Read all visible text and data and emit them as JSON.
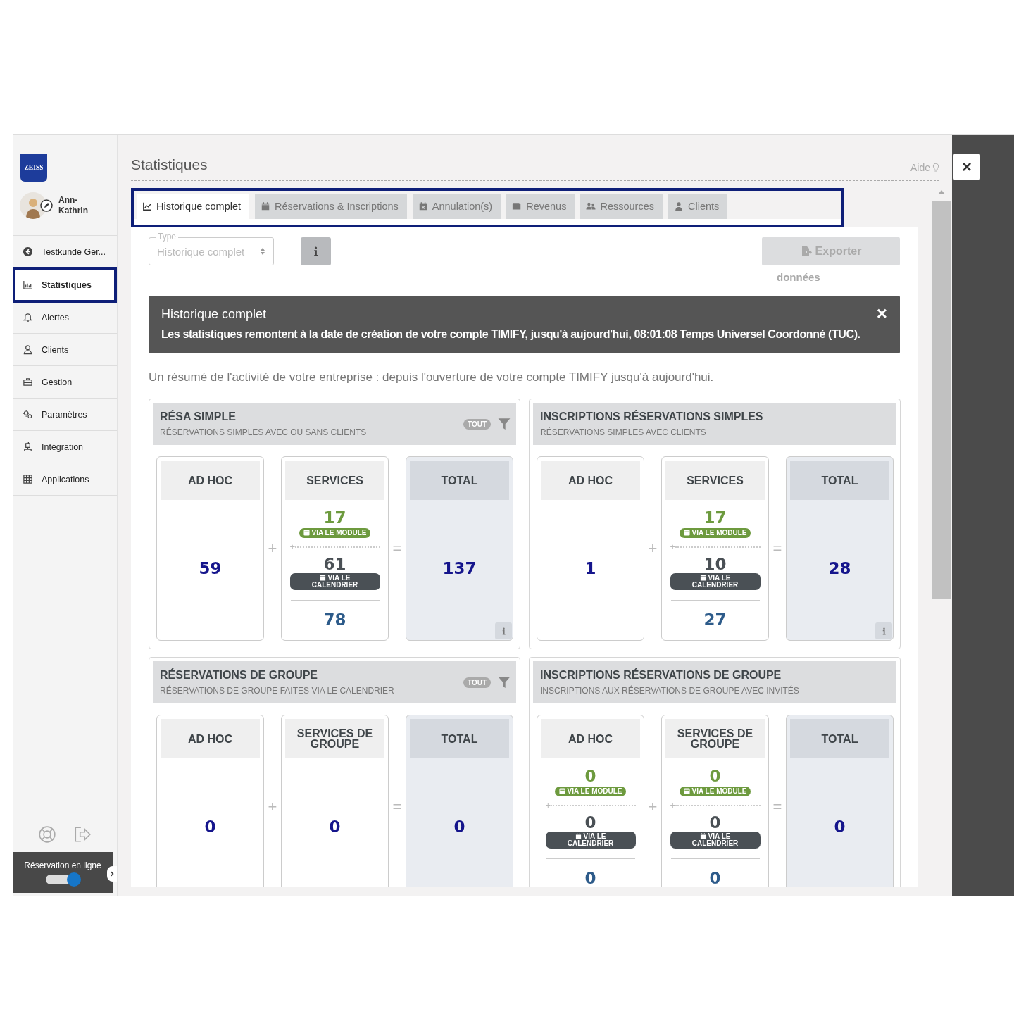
{
  "sidebar": {
    "logo": "ZEISS",
    "user": "Ann-Kathrin",
    "items": [
      {
        "label": "Testkunde Ger...",
        "selected": false
      },
      {
        "label": "Statistiques",
        "selected": true
      },
      {
        "label": "Alertes",
        "selected": false
      },
      {
        "label": "Clients",
        "selected": false
      },
      {
        "label": "Gestion",
        "selected": false
      },
      {
        "label": "Paramètres",
        "selected": false
      },
      {
        "label": "Intégration",
        "selected": false
      },
      {
        "label": "Applications",
        "selected": false
      }
    ],
    "footer": {
      "label": "Réservation en ligne",
      "on": true
    }
  },
  "header": {
    "title": "Statistiques",
    "help": "Aide"
  },
  "tabs": [
    {
      "label": "Historique complet",
      "selected": true
    },
    {
      "label": "Réservations & Inscriptions",
      "selected": false
    },
    {
      "label": "Annulation(s)",
      "selected": false
    },
    {
      "label": "Revenus",
      "selected": false
    },
    {
      "label": "Ressources",
      "selected": false
    },
    {
      "label": "Clients",
      "selected": false
    }
  ],
  "toolbar": {
    "type_field": {
      "label": "Type",
      "value": "Historique complet",
      "disabled": true
    },
    "export": {
      "label": "Exporter",
      "sublabel": "données",
      "disabled": true
    }
  },
  "alert": {
    "title": "Historique complet",
    "text": "Les statistiques remontent à la date de création de votre compte TIMIFY, jusqu'à aujourd'hui, 08:01:08 Temps Universel Coordonné (TUC).",
    "close": "×"
  },
  "intro": "Un résumé de l'activité de votre entreprise : depuis l'ouverture de votre compte TIMIFY jusqu'à aujourd'hui.",
  "cards": [
    {
      "title": "RÉSA SIMPLE",
      "subtitle": "RÉSERVATIONS SIMPLES AVEC OU SANS CLIENTS",
      "filter": "TOUT",
      "operators": [
        "+",
        "="
      ],
      "columns": [
        {
          "kind": "simple",
          "heading": "AD HOC",
          "value": "59"
        },
        {
          "kind": "split",
          "heading": "SERVICES",
          "module": "17",
          "module_label": "VIA LE MODULE",
          "split_sign": "+",
          "calendar": "61",
          "calendar_label": "VIA LE CALENDRIER",
          "sum": "78"
        },
        {
          "kind": "total",
          "heading": "TOTAL",
          "value": "137",
          "info": true
        }
      ]
    },
    {
      "title": "INSCRIPTIONS RÉSERVATIONS SIMPLES",
      "subtitle": "RÉSERVATIONS SIMPLES AVEC CLIENTS",
      "operators": [
        "+",
        "="
      ],
      "columns": [
        {
          "kind": "simple",
          "heading": "AD HOC",
          "value": "1"
        },
        {
          "kind": "split",
          "heading": "SERVICES",
          "module": "17",
          "module_label": "VIA LE MODULE",
          "split_sign": "+",
          "calendar": "10",
          "calendar_label": "VIA LE CALENDRIER",
          "sum": "27"
        },
        {
          "kind": "total",
          "heading": "TOTAL",
          "value": "28",
          "info": true
        }
      ]
    },
    {
      "title": "RÉSERVATIONS DE GROUPE",
      "subtitle": "RÉSERVATIONS DE GROUPE FAITES VIA LE CALENDRIER",
      "filter": "TOUT",
      "operators": [
        "+",
        "="
      ],
      "columns": [
        {
          "kind": "simple",
          "heading": "AD HOC",
          "value": "0"
        },
        {
          "kind": "simple",
          "heading": "SERVICES DE GROUPE",
          "value": "0"
        },
        {
          "kind": "total",
          "heading": "TOTAL",
          "value": "0"
        }
      ]
    },
    {
      "title": "INSCRIPTIONS RÉSERVATIONS DE GROUPE",
      "subtitle": "INSCRIPTIONS AUX RÉSERVATIONS DE GROUPE AVEC INVITÉS",
      "operators": [
        "+",
        "="
      ],
      "columns": [
        {
          "kind": "split",
          "heading": "AD HOC",
          "module": "0",
          "module_label": "VIA LE MODULE",
          "split_sign": "+",
          "calendar": "0",
          "calendar_label": "VIA LE CALENDRIER",
          "sum": "0"
        },
        {
          "kind": "split",
          "heading": "SERVICES DE GROUPE",
          "module": "0",
          "module_label": "VIA LE MODULE",
          "split_sign": "+",
          "calendar": "0",
          "calendar_label": "VIA LE CALENDRIER",
          "sum": "0"
        },
        {
          "kind": "total",
          "heading": "TOTAL",
          "value": "0"
        }
      ]
    }
  ],
  "overlay": {
    "close": "×"
  }
}
